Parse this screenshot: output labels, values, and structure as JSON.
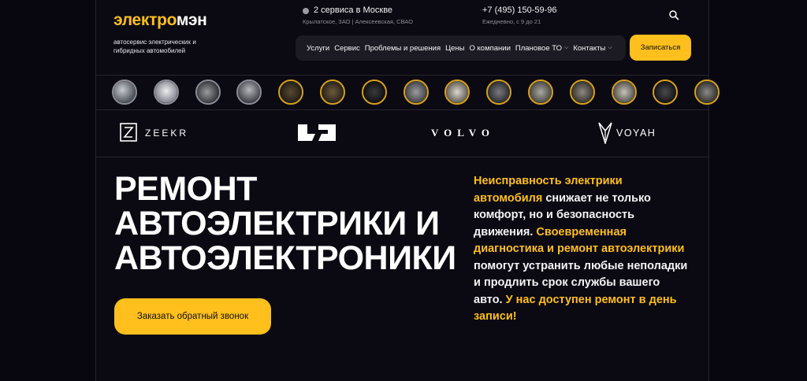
{
  "header": {
    "logo_part1": "электро",
    "logo_part2": "мэн",
    "tagline": "автосервис электрических и гибридных автомобилей",
    "location_title": "2 сервиса в Москве",
    "location_addresses": "Крылатское, ЗАО | Алексеевская, СВАО",
    "phone": "+7 (495) 150-59-96",
    "hours": "Ежедневно, с 9 до 21",
    "search_icon": "search-icon",
    "cta_label": "Записаться"
  },
  "nav": {
    "items": [
      {
        "label": "Услуги"
      },
      {
        "label": "Сервис"
      },
      {
        "label": "Проблемы и решения"
      },
      {
        "label": "Цены"
      },
      {
        "label": "О компании"
      },
      {
        "label": "Плановое ТО",
        "has_dropdown": true
      },
      {
        "label": "Контакты",
        "has_dropdown": true
      }
    ]
  },
  "thumbnails_count": 15,
  "brands": [
    {
      "name": "ZEEKR",
      "icon": "zeekr-logo"
    },
    {
      "name": "LI",
      "icon": "li-auto-logo"
    },
    {
      "name": "VOLVO",
      "icon": "volvo-logo"
    },
    {
      "name": "VOYAH",
      "icon": "voyah-logo"
    }
  ],
  "hero": {
    "line1": "РЕМОНТ",
    "line2": "АВТОЭЛЕКТРИКИ И",
    "line3": "АВТОЭЛЕКТРОНИКИ",
    "cta_label": "Заказать обратный звонок"
  },
  "description": {
    "p1_highlight": "Неисправность электрики автомобиля",
    "p2": " снижает не только комфорт, но и безопасность движения. ",
    "p3_highlight": "Своевременная диагностика и ремонт автоэлектрики",
    "p4": " помогут устранить любые неполадки и продлить срок службы вашего авто. ",
    "p5_highlight": "У нас доступен ремонт в день записи!"
  },
  "colors": {
    "accent": "#ffbf1c",
    "background": "#0b0a13",
    "nav_bg": "#1c1b24"
  }
}
